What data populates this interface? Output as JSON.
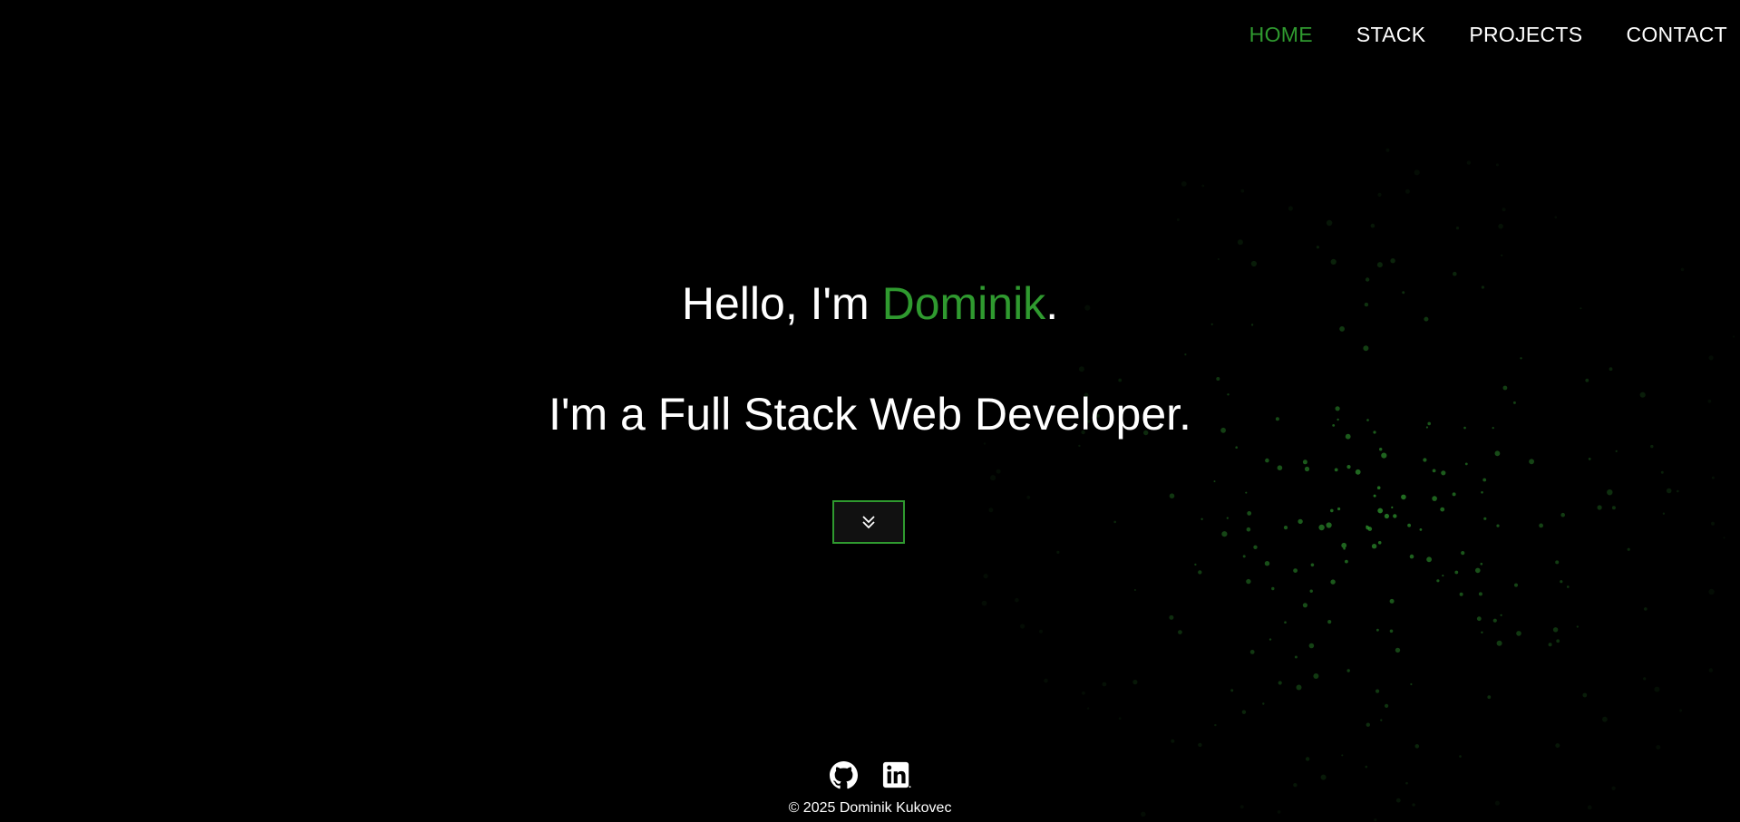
{
  "nav": {
    "items": [
      {
        "label": "HOME",
        "active": true
      },
      {
        "label": "STACK",
        "active": false
      },
      {
        "label": "PROJECTS",
        "active": false
      },
      {
        "label": "CONTACT",
        "active": false
      }
    ]
  },
  "hero": {
    "greeting_prefix": "Hello, I'm ",
    "name": "Dominik",
    "greeting_suffix": ".",
    "subtitle": "I'm a Full Stack Web Developer."
  },
  "scroll_button": {
    "icon": "double-chevron-down-icon"
  },
  "footer": {
    "socials": [
      {
        "name": "github-icon"
      },
      {
        "name": "linkedin-icon"
      }
    ],
    "copyright": "© 2025 Dominik Kukovec"
  },
  "colors": {
    "accent": "#2f9a2f",
    "background": "#000000",
    "text": "#ffffff"
  }
}
